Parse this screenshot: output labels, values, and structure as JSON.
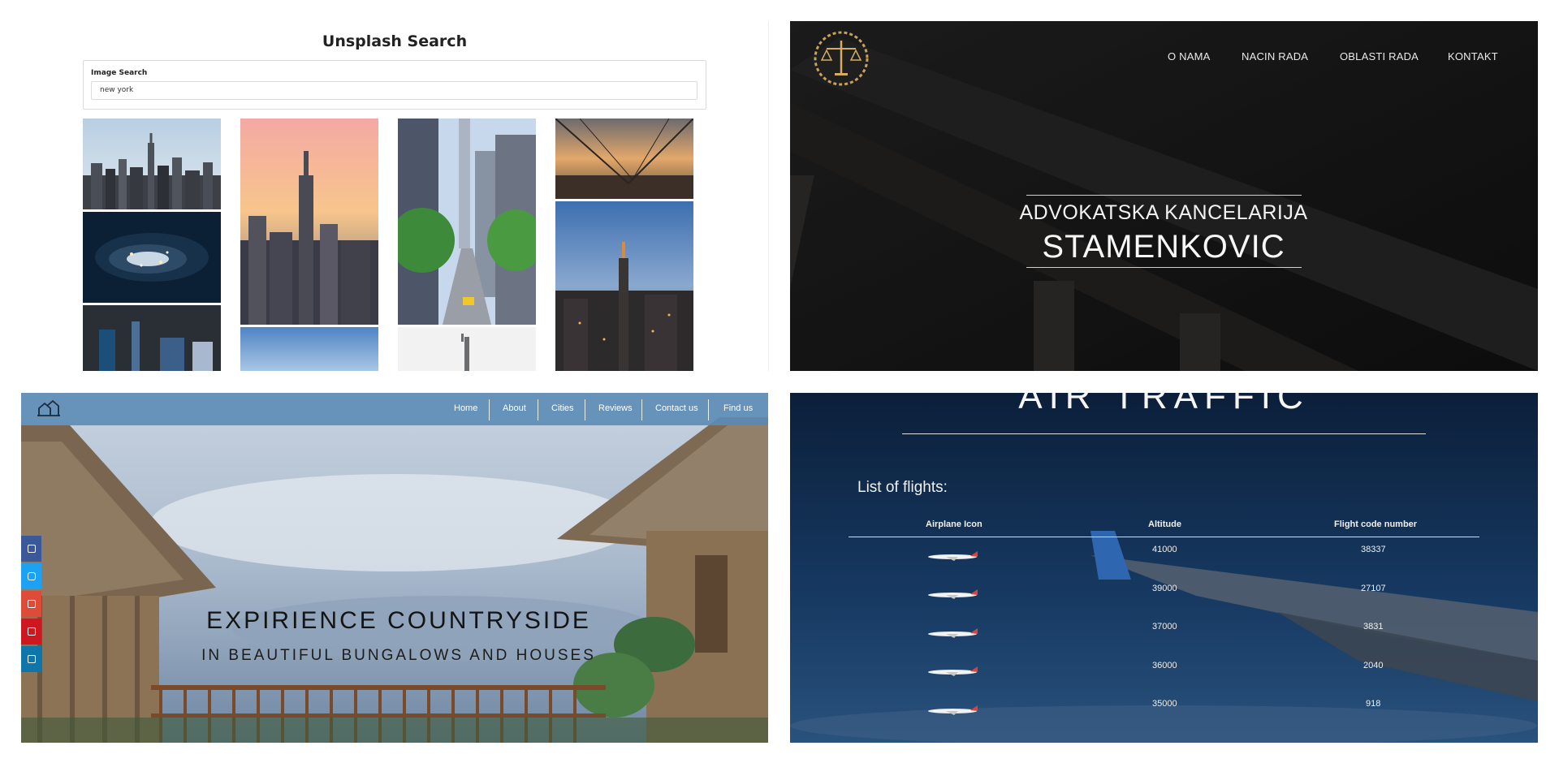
{
  "unsplash": {
    "title": "Unsplash Search",
    "field_label": "Image Search",
    "query": "new york",
    "images": [
      "city skyline",
      "city at night aerial",
      "neon street",
      "empire state sunset",
      "sky",
      "street with taxi",
      "statue",
      "bridge sunset",
      "city dusk"
    ]
  },
  "law": {
    "logo": "scales-logo",
    "nav": [
      "O NAMA",
      "NACIN RADA",
      "OBLASTI RADA",
      "KONTAKT"
    ],
    "hero_line1": "ADVOKATSKA KANCELARIJA",
    "hero_line2": "STAMENKOVIC"
  },
  "countryside": {
    "logo": "house-logo-icon",
    "nav": [
      "Home",
      "About",
      "Cities",
      "Reviews",
      "Contact us",
      "Find us"
    ],
    "social": [
      "facebook-icon",
      "instagram-icon",
      "google-plus-icon",
      "youtube-icon",
      "message-icon"
    ],
    "social_colors": [
      "#3b5998",
      "#1da1f2",
      "#dd4b39",
      "#cc181e",
      "#0e76a8"
    ],
    "hero_line1": "EXPIRIENCE COUNTRYSIDE",
    "hero_line2": "IN BEAUTIFUL BUNGALOWS AND HOUSES"
  },
  "air": {
    "title": "AIR TRAFFIC",
    "list_title": "List of flights:",
    "columns": [
      "Airplane Icon",
      "Altitude",
      "Flight code number"
    ],
    "rows": [
      {
        "altitude": "41000",
        "code": "38337"
      },
      {
        "altitude": "39000",
        "code": "27107"
      },
      {
        "altitude": "37000",
        "code": "3831"
      },
      {
        "altitude": "36000",
        "code": "2040"
      },
      {
        "altitude": "35000",
        "code": "918"
      }
    ]
  }
}
